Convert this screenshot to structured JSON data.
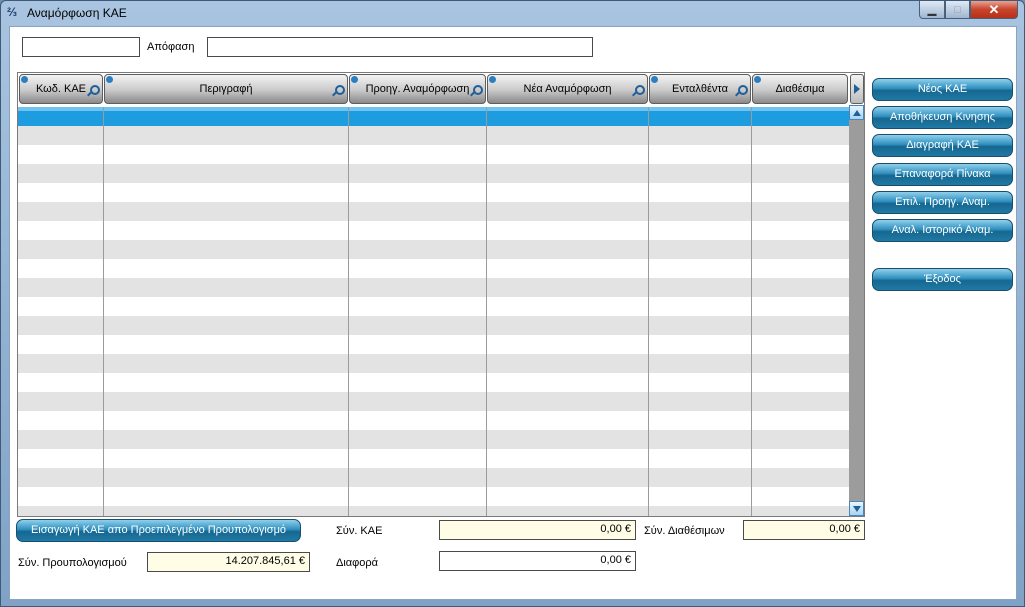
{
  "window": {
    "title": "Αναμόρφωση ΚΑΕ",
    "app_icon": "app-icon",
    "minimize_glyph": "▁",
    "maximize_glyph": "□",
    "close_glyph": "✕"
  },
  "top": {
    "code_value": "",
    "decision_label": "Απόφαση",
    "decision_value": ""
  },
  "grid": {
    "columns": [
      {
        "label": "Κωδ. ΚΑΕ",
        "searchable": true
      },
      {
        "label": "Περιγραφή",
        "searchable": true
      },
      {
        "label": "Προηγ. Αναμόρφωση",
        "searchable": true
      },
      {
        "label": "Νέα Αναμόρφωση",
        "searchable": true
      },
      {
        "label": "Ενταλθέντα",
        "searchable": true
      },
      {
        "label": "Διαθέσιμα",
        "searchable": false
      }
    ],
    "rows": [],
    "selected_row": 1,
    "colors": {
      "selected": "#1e9ce0",
      "alt_row": "#e3e3e3"
    }
  },
  "sidebar": {
    "new_kae": "Νέος ΚΑΕ",
    "save_movement": "Αποθήκευση Κινησης",
    "delete_kae": "Διαγραφή ΚΑΕ",
    "reset_table": "Επαναφορά Πίνακα",
    "select_prev": "Επιλ. Προηγ. Αναμ.",
    "history": "Αναλ. Ιστορικό Αναμ.",
    "exit": "Έξοδος"
  },
  "bottom": {
    "import_button": "Εισαγωγή ΚΑΕ απο Προεπιλεγμένο Προυπολογισμό",
    "total_budget_label": "Σύν. Προυπολογισμού",
    "total_budget_value": "14.207.845,61 €",
    "total_kae_label": "Σύν. ΚΑΕ",
    "total_kae_value": "0,00 €",
    "difference_label": "Διαφορά",
    "difference_value": "0,00 €",
    "total_available_label": "Σύν. Διαθέσιμων",
    "total_available_value": "0,00 €"
  },
  "accent": "#1f7aa5"
}
